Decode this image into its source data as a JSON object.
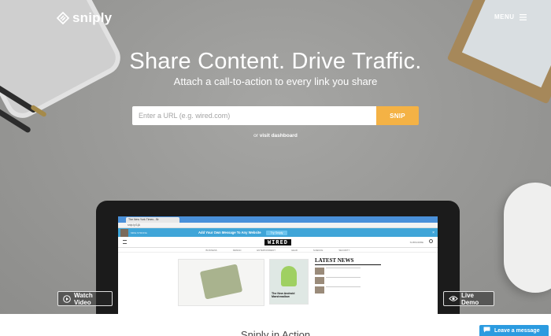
{
  "header": {
    "logo_text": "sniply",
    "menu_label": "MENU"
  },
  "hero": {
    "headline": "Share Content. Drive Traffic.",
    "subheadline": "Attach a call-to-action to every link you share",
    "url_input_placeholder": "Enter a URL (e.g. wired.com)",
    "snip_button": "SNIP",
    "dashboard_prefix": "or",
    "dashboard_link": "visit dashboard"
  },
  "laptop_screen": {
    "browser_tab": "The New York Times - Br",
    "browser_url": "snip.ly/1jA",
    "sniply_name": "MIKE STRONG",
    "sniply_message": "Add Your Own Message To Any Website",
    "sniply_cta": "Try Sniply",
    "site_logo": "WIRED",
    "site_subscribe": "SUBSCRIBE",
    "nav": [
      "BUSINESS",
      "DESIGN",
      "ENTERTAINMENT",
      "GEAR",
      "SCIENCE",
      "SECURITY"
    ],
    "card_caption": "The New Android Marshmallow",
    "news_title": "LATEST NEWS"
  },
  "buttons": {
    "watch_video": "Watch Video",
    "live_demo": "Live Demo"
  },
  "section": {
    "title": "Sniply in Action"
  },
  "chat": {
    "label": "Leave a message"
  },
  "colors": {
    "accent_orange": "#f4b245",
    "chat_blue": "#2b9be0",
    "sniply_bar_blue": "#3fa5d8"
  }
}
